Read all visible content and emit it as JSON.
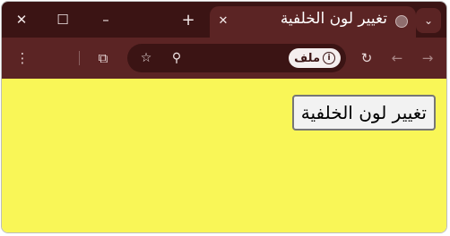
{
  "browser": {
    "window_controls": {
      "close": "✕",
      "maximize": "☐",
      "minimize": "–"
    },
    "new_tab": "+",
    "tab": {
      "title": "تغيير لون الخلفية",
      "close": "✕"
    },
    "tab_search": "⌄",
    "toolbar": {
      "back": "←",
      "forward": "→",
      "reload": "↻",
      "bookmark": "☆",
      "zoom": "⚲",
      "extensions": "⧉",
      "menu": "⋮"
    },
    "omnibox": {
      "site_label": "ملف",
      "info": "i"
    }
  },
  "page": {
    "background_color": "#f9f657",
    "button_label": "تغيير لون الخلفية"
  }
}
